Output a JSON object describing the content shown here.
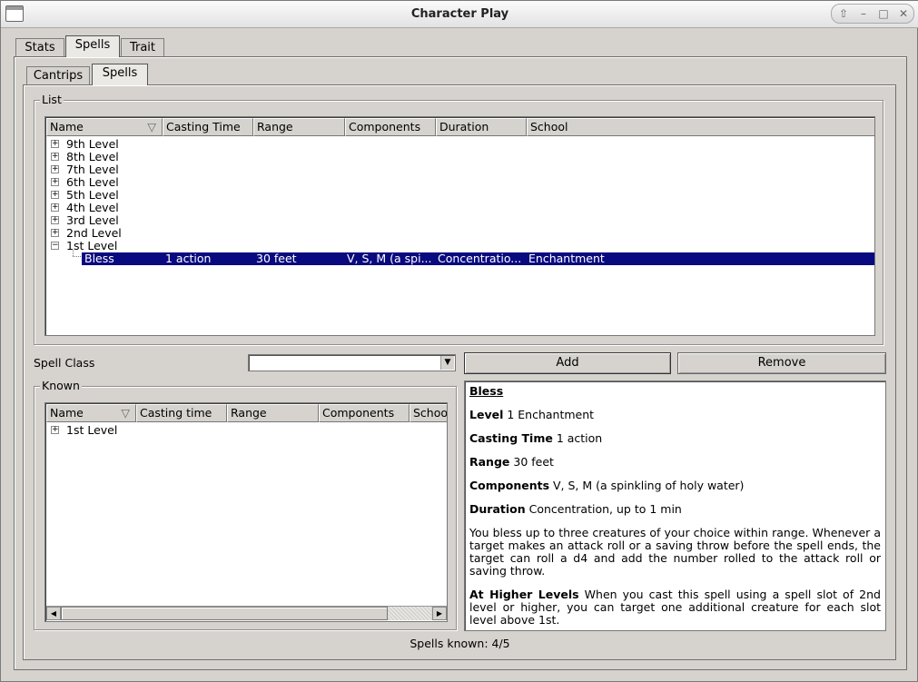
{
  "window": {
    "title": "Character Play"
  },
  "main_tabs": [
    {
      "label": "Stats"
    },
    {
      "label": "Spells"
    },
    {
      "label": "Trait"
    }
  ],
  "sub_tabs": [
    {
      "label": "Cantrips"
    },
    {
      "label": "Spells"
    }
  ],
  "list_group": {
    "title": "List",
    "columns": [
      "Name",
      "Casting Time",
      "Range",
      "Components",
      "Duration",
      "School"
    ],
    "levels": [
      "9th Level",
      "8th Level",
      "7th Level",
      "6th Level",
      "5th Level",
      "4th Level",
      "3rd Level",
      "2nd Level",
      "1st Level"
    ],
    "selected_row": {
      "name": "Bless",
      "casting_time": "1 action",
      "range": "30 feet",
      "components": "V, S, M (a spi...",
      "duration": "Concentratio...",
      "school": "Enchantment"
    }
  },
  "spell_class": {
    "label": "Spell Class",
    "value": ""
  },
  "buttons": {
    "add": "Add",
    "remove": "Remove"
  },
  "known_group": {
    "title": "Known",
    "columns": [
      "Name",
      "Casting time",
      "Range",
      "Components",
      "Schoo"
    ],
    "levels": [
      "1st Level"
    ]
  },
  "detail": {
    "name": "Bless",
    "level_label": "Level",
    "level_value": "1 Enchantment",
    "casting_label": "Casting Time",
    "casting_value": "1 action",
    "range_label": "Range",
    "range_value": "30 feet",
    "components_label": "Components",
    "components_value": "V, S, M (a spinkling of holy water)",
    "duration_label": "Duration",
    "duration_value": "Concentration, up to 1 min",
    "description": "You bless up to three creatures of your choice within range. Whenever a target makes an attack roll or a saving throw before the spell ends, the target can roll a d4 and add the number rolled to the attack roll or saving throw.",
    "higher_label": "At Higher Levels",
    "higher_text": "When you cast this spell using a spell slot of 2nd level or higher, you can target one additional creature for each slot level above 1st."
  },
  "status": {
    "spells_known": "Spells known: 4/5"
  }
}
